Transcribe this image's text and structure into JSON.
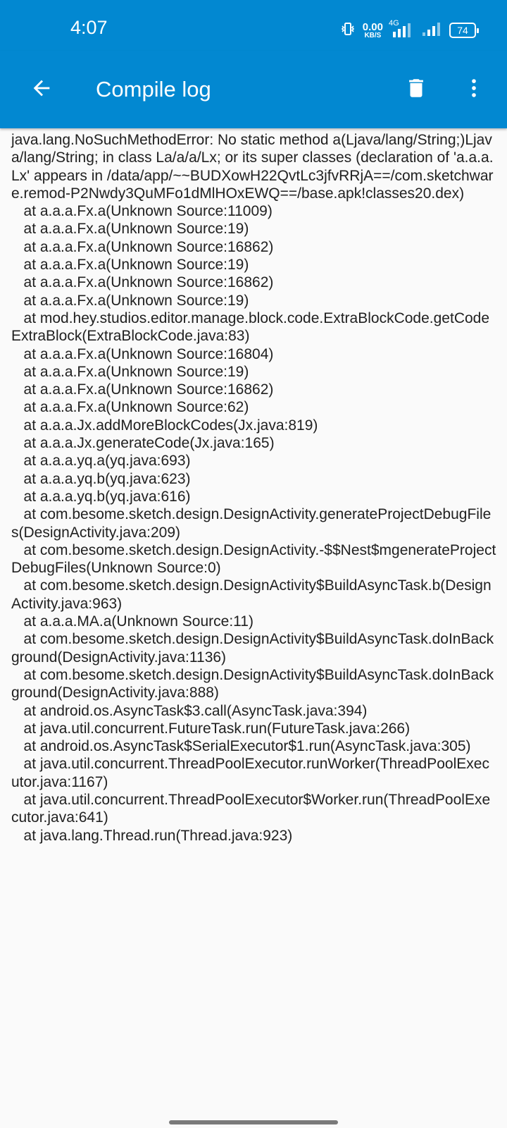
{
  "status_bar": {
    "time": "4:07",
    "net_speed_value": "0.00",
    "net_speed_unit": "KB/S",
    "network_type": "4G",
    "battery_level": "74"
  },
  "app_bar": {
    "title": "Compile log",
    "back_icon": "arrow-left-icon",
    "delete_icon": "trash-icon",
    "more_icon": "more-vertical-icon",
    "background_color": "#0288d1"
  },
  "log_text": "java.lang.NoSuchMethodError: No static method a(Ljava/lang/String;)Ljava/lang/String; in class La/a/a/Lx; or its super classes (declaration of 'a.a.a.Lx' appears in /data/app/~~BUDXowH22QvtLc3jfvRRjA==/com.sketchware.remod-P2Nwdy3QuMFo1dMlHOxEWQ==/base.apk!classes20.dex)\n   at a.a.a.Fx.a(Unknown Source:11009)\n   at a.a.a.Fx.a(Unknown Source:19)\n   at a.a.a.Fx.a(Unknown Source:16862)\n   at a.a.a.Fx.a(Unknown Source:19)\n   at a.a.a.Fx.a(Unknown Source:16862)\n   at a.a.a.Fx.a(Unknown Source:19)\n   at mod.hey.studios.editor.manage.block.code.ExtraBlockCode.getCodeExtraBlock(ExtraBlockCode.java:83)\n   at a.a.a.Fx.a(Unknown Source:16804)\n   at a.a.a.Fx.a(Unknown Source:19)\n   at a.a.a.Fx.a(Unknown Source:16862)\n   at a.a.a.Fx.a(Unknown Source:62)\n   at a.a.a.Jx.addMoreBlockCodes(Jx.java:819)\n   at a.a.a.Jx.generateCode(Jx.java:165)\n   at a.a.a.yq.a(yq.java:693)\n   at a.a.a.yq.b(yq.java:623)\n   at a.a.a.yq.b(yq.java:616)\n   at com.besome.sketch.design.DesignActivity.generateProjectDebugFiles(DesignActivity.java:209)\n   at com.besome.sketch.design.DesignActivity.-$$Nest$mgenerateProjectDebugFiles(Unknown Source:0)\n   at com.besome.sketch.design.DesignActivity$BuildAsyncTask.b(DesignActivity.java:963)\n   at a.a.a.MA.a(Unknown Source:11)\n   at com.besome.sketch.design.DesignActivity$BuildAsyncTask.doInBackground(DesignActivity.java:1136)\n   at com.besome.sketch.design.DesignActivity$BuildAsyncTask.doInBackground(DesignActivity.java:888)\n   at android.os.AsyncTask$3.call(AsyncTask.java:394)\n   at java.util.concurrent.FutureTask.run(FutureTask.java:266)\n   at android.os.AsyncTask$SerialExecutor$1.run(AsyncTask.java:305)\n   at java.util.concurrent.ThreadPoolExecutor.runWorker(ThreadPoolExecutor.java:1167)\n   at java.util.concurrent.ThreadPoolExecutor$Worker.run(ThreadPoolExecutor.java:641)\n   at java.lang.Thread.run(Thread.java:923)"
}
